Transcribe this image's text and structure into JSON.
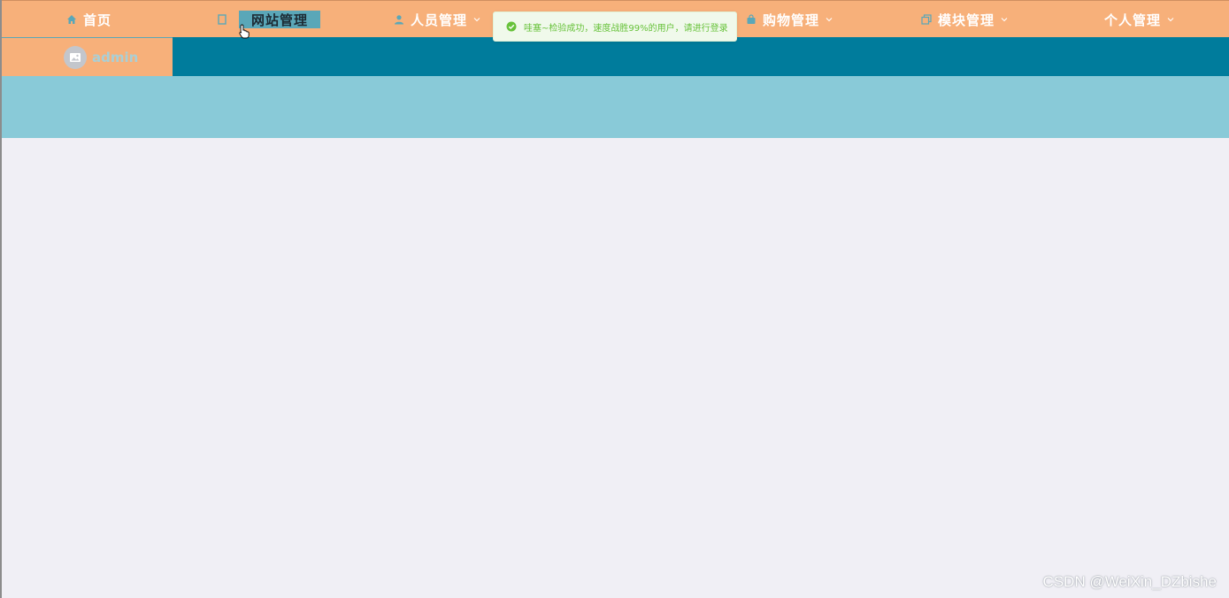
{
  "nav": {
    "home": "首页",
    "site": "网站管理",
    "people": "人员管理",
    "shop": "购物管理",
    "module": "模块管理",
    "personal": "个人管理"
  },
  "toast": {
    "message": "哇塞~检验成功，速度战胜99%的用户，请进行登录"
  },
  "user": {
    "name": "admin"
  },
  "watermark": "CSDN @WeiXin_DZbishe",
  "colors": {
    "nav_bg": "#f7b07a",
    "subbar_bg": "#007c9c",
    "band_bg": "#89cad8",
    "content_bg": "#f0eff5",
    "highlight": "#5aa7b8",
    "toast_text": "#67c23a"
  },
  "icons": {
    "home": "home-icon",
    "site": "document-icon",
    "people": "user-icon",
    "shop": "bag-icon",
    "module": "copy-icon",
    "toast": "check-circle-icon",
    "avatar": "image-icon"
  }
}
